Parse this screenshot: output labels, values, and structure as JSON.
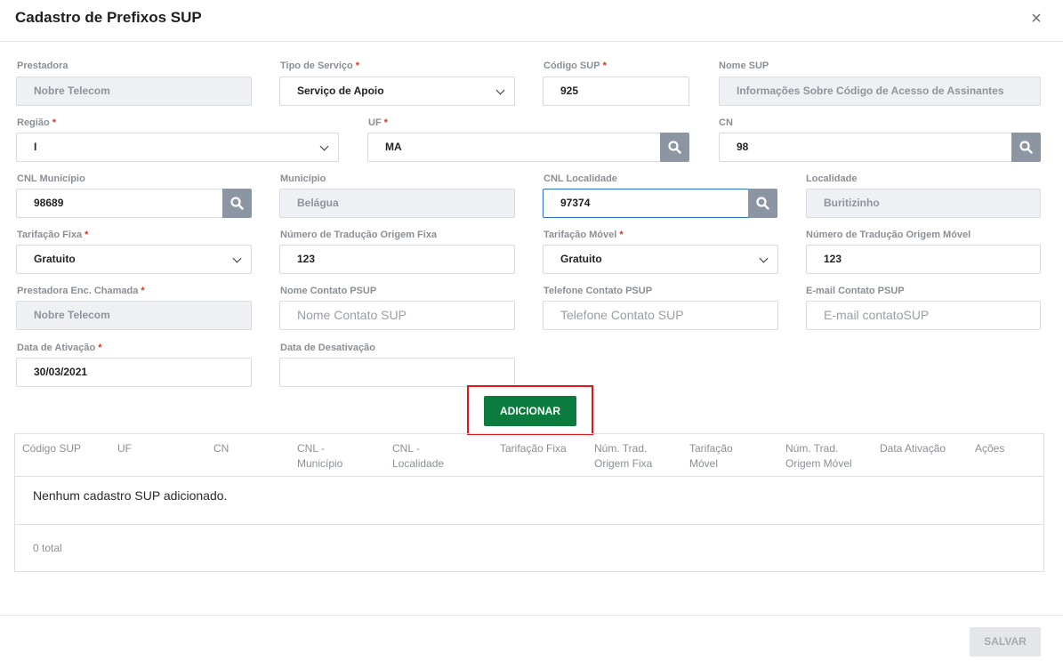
{
  "modal": {
    "title": "Cadastro de Prefixos SUP",
    "close_glyph": "×"
  },
  "form": {
    "prestadora": {
      "label": "Prestadora",
      "value": "Nobre Telecom"
    },
    "tipo_servico": {
      "label": "Tipo de Serviço",
      "required": "*",
      "value": "Serviço de Apoio"
    },
    "codigo_sup": {
      "label": "Código SUP",
      "required": "*",
      "value": "925"
    },
    "nome_sup": {
      "label": "Nome SUP",
      "value": "Informações Sobre Código de Acesso de Assinantes"
    },
    "regiao": {
      "label": "Região",
      "required": "*",
      "value": "I"
    },
    "uf": {
      "label": "UF",
      "required": "*",
      "value": "MA"
    },
    "cn": {
      "label": "CN",
      "value": "98"
    },
    "cnl_municipio": {
      "label": "CNL Município",
      "value": "98689"
    },
    "municipio": {
      "label": "Município",
      "value": "Belágua"
    },
    "cnl_localidade": {
      "label": "CNL Localidade",
      "value": "97374"
    },
    "localidade": {
      "label": "Localidade",
      "value": "Buritizinho"
    },
    "tarifacao_fixa": {
      "label": "Tarifação Fixa",
      "required": "*",
      "value": "Gratuito"
    },
    "num_trad_fixa": {
      "label": "Número de Tradução Origem Fixa",
      "value": "123"
    },
    "tarifacao_movel": {
      "label": "Tarifação Móvel",
      "required": "*",
      "value": "Gratuito"
    },
    "num_trad_movel": {
      "label": "Número de Tradução Origem Móvel",
      "value": "123"
    },
    "prestadora_enc": {
      "label": "Prestadora Enc. Chamada",
      "required": "*",
      "value": "Nobre Telecom"
    },
    "nome_contato": {
      "label": "Nome Contato PSUP",
      "placeholder": "Nome Contato SUP"
    },
    "telefone_contato": {
      "label": "Telefone Contato PSUP",
      "placeholder": "Telefone Contato SUP"
    },
    "email_contato": {
      "label": "E-mail Contato PSUP",
      "placeholder": "E-mail contatoSUP"
    },
    "data_ativacao": {
      "label": "Data de Ativação",
      "required": "*",
      "value": "30/03/2021"
    },
    "data_desativacao": {
      "label": "Data de Desativação",
      "value": ""
    }
  },
  "add_button": {
    "label": "ADICIONAR"
  },
  "table": {
    "headers": {
      "codigo_sup": "Código SUP",
      "uf": "UF",
      "cn": "CN",
      "cnl_municipio_1": "CNL -",
      "cnl_municipio_2": "Município",
      "cnl_localidade_1": "CNL -",
      "cnl_localidade_2": "Localidade",
      "tarifacao_fixa": "Tarifação Fixa",
      "num_trad_fixa_1": "Núm. Trad.",
      "num_trad_fixa_2": "Origem Fixa",
      "tarifacao_movel_1": "Tarifação",
      "tarifacao_movel_2": "Móvel",
      "num_trad_movel_1": "Núm. Trad.",
      "num_trad_movel_2": "Origem Móvel",
      "data_ativacao": "Data Ativação",
      "acoes": "Ações"
    },
    "empty_message": "Nenhum cadastro SUP adicionado.",
    "total": "0 total"
  },
  "save_button": {
    "label": "SALVAR"
  },
  "icons": {
    "search": "search-icon",
    "chevron": "chevron-down-icon",
    "close": "close-icon"
  },
  "colors": {
    "primary_green": "#0b7b3e",
    "highlight_red": "#e0151b",
    "search_button_gray": "#8c96a3"
  }
}
